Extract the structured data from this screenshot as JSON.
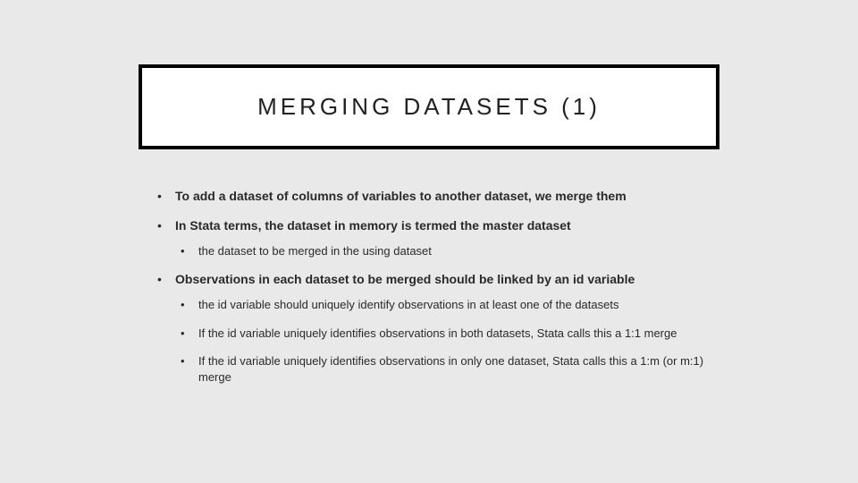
{
  "slide": {
    "title": "MERGING DATASETS (1)",
    "bullets": {
      "b1": "To add a dataset of columns of variables to another dataset, we merge them",
      "b2": "In Stata terms, the dataset in memory is termed the master dataset",
      "b2_sub1": "the dataset to be merged in the using dataset",
      "b3": "Observations in each dataset to be merged should be linked by an id variable",
      "b3_sub1": "the id variable should uniquely identify observations in at least one of the datasets",
      "b3_sub2": "If the id variable uniquely identifies observations in both datasets, Stata calls this a 1:1 merge",
      "b3_sub3": "If the id variable uniquely identifies observations in only one dataset, Stata calls this a 1:m (or m:1) merge"
    }
  }
}
